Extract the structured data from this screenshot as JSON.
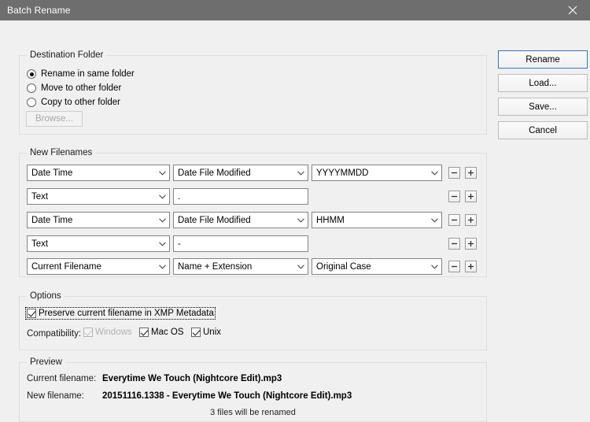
{
  "window": {
    "title": "Batch Rename",
    "close_icon": "close-icon",
    "titlebar_color": "#6e6e6e",
    "body_color": "#f0f0f0",
    "accent_color": "#2a6fc7"
  },
  "buttons": {
    "rename": "Rename",
    "load": "Load...",
    "save": "Save...",
    "cancel": "Cancel",
    "browse": "Browse..."
  },
  "destination": {
    "legend": "Destination Folder",
    "options": [
      {
        "label": "Rename in same folder",
        "checked": true
      },
      {
        "label": "Move to other folder",
        "checked": false
      },
      {
        "label": "Copy to other folder",
        "checked": false
      }
    ]
  },
  "new_filenames": {
    "legend": "New Filenames",
    "rows": [
      {
        "type_value": "Date Time",
        "second_kind": "combo",
        "second_value": "Date File Modified",
        "third_kind": "combo",
        "third_value": "YYYYMMDD",
        "minus": "−",
        "plus": "+"
      },
      {
        "type_value": "Text",
        "second_kind": "text",
        "second_value": ".",
        "third_kind": "none",
        "third_value": "",
        "minus": "−",
        "plus": "+"
      },
      {
        "type_value": "Date Time",
        "second_kind": "combo",
        "second_value": "Date File Modified",
        "third_kind": "combo",
        "third_value": "HHMM",
        "minus": "−",
        "plus": "+"
      },
      {
        "type_value": "Text",
        "second_kind": "text",
        "second_value": "-",
        "third_kind": "none",
        "third_value": "",
        "minus": "−",
        "plus": "+"
      },
      {
        "type_value": "Current Filename",
        "second_kind": "combo",
        "second_value": "Name + Extension",
        "third_kind": "combo",
        "third_value": "Original Case",
        "minus": "−",
        "plus": "+"
      }
    ]
  },
  "options": {
    "legend": "Options",
    "preserve": {
      "label": "Preserve current filename in XMP Metadata",
      "checked": true,
      "focused": true
    },
    "compatibility_label": "Compatibility:",
    "compatibility": [
      {
        "label": "Windows",
        "checked": true,
        "disabled": true
      },
      {
        "label": "Mac OS",
        "checked": true,
        "disabled": false
      },
      {
        "label": "Unix",
        "checked": true,
        "disabled": false
      }
    ]
  },
  "preview": {
    "legend": "Preview",
    "current_label": "Current filename:",
    "current_value": "Everytime We Touch (Nightcore Edit).mp3",
    "new_label": "New filename:",
    "new_value": "20151116.1338 - Everytime We Touch (Nightcore Edit).mp3",
    "count_text": "3 files will be renamed"
  }
}
